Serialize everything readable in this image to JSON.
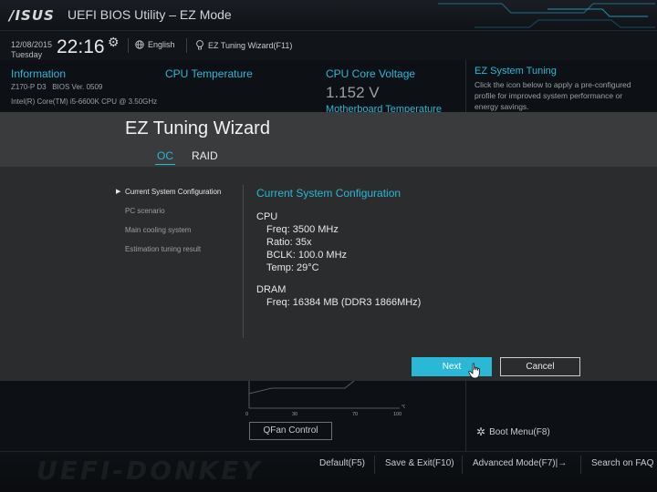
{
  "header": {
    "logo": "/ISUS",
    "title": "UEFI BIOS Utility – EZ Mode"
  },
  "info_bar": {
    "date": "12/08/2015",
    "day": "Tuesday",
    "time": "22:16",
    "language": "English",
    "wizard_link": "EZ Tuning Wizard(F11)"
  },
  "background": {
    "information": {
      "heading": "Information",
      "board": "Z170-P D3",
      "bios": "BIOS Ver. 0509",
      "cpu": "Intel(R) Core(TM) i5-6600K CPU @ 3.50GHz"
    },
    "cpu_temperature": {
      "heading": "CPU Temperature"
    },
    "cpu_core_voltage": {
      "heading": "CPU Core Voltage",
      "value": "1.152 V"
    },
    "motherboard_temperature": {
      "heading": "Motherboard Temperature"
    },
    "ez_system_tuning": {
      "heading": "EZ System Tuning",
      "description": "Click the icon below to apply a pre-configured profile for improved system performance or energy savings."
    },
    "fan_chart": {
      "x_ticks": [
        "0",
        "30",
        "70",
        "100"
      ],
      "unit": "°C"
    },
    "qfan_button": "QFan Control",
    "boot_menu": "Boot Menu(F8)"
  },
  "wizard": {
    "title": "EZ Tuning Wizard",
    "tabs": [
      {
        "label": "OC",
        "active": true
      },
      {
        "label": "RAID",
        "active": false
      }
    ],
    "steps": [
      {
        "label": "Current System Configuration",
        "active": true
      },
      {
        "label": "PC scenario",
        "active": false
      },
      {
        "label": "Main cooling system",
        "active": false
      },
      {
        "label": "Estimation tuning result",
        "active": false
      }
    ],
    "config": {
      "title": "Current System Configuration",
      "cpu_heading": "CPU",
      "cpu_lines": [
        "Freq: 3500 MHz",
        "Ratio: 35x",
        "BCLK: 100.0 MHz",
        "Temp: 29°C"
      ],
      "dram_heading": "DRAM",
      "dram_lines": [
        "Freq: 16384 MB (DDR3 1866MHz)"
      ]
    },
    "buttons": {
      "next": "Next",
      "cancel": "Cancel"
    }
  },
  "bottom_bar": {
    "default": "Default(F5)",
    "save_exit": "Save & Exit(F10)",
    "advanced": "Advanced Mode(F7)|→",
    "search": "Search on FAQ"
  },
  "watermark": "UEFI-DONKEY"
}
